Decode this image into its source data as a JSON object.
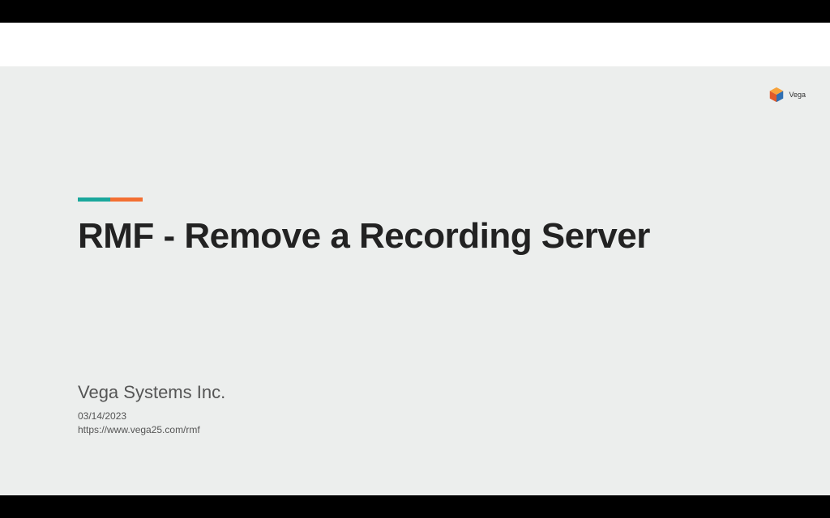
{
  "logo": {
    "brand": "Vega"
  },
  "slide": {
    "title": "RMF - Remove a Recording Server",
    "company": "Vega Systems Inc.",
    "date": "03/14/2023",
    "url": "https://www.vega25.com/rmf"
  },
  "colors": {
    "accent_teal": "#1aa79c",
    "accent_orange": "#f36f32",
    "background": "#eceeed"
  }
}
